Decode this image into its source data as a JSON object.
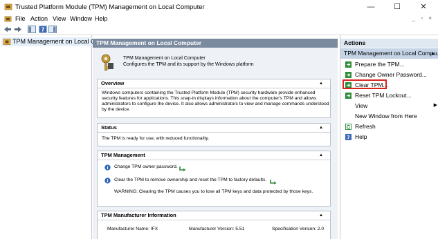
{
  "window": {
    "title": "Trusted Platform Module (TPM) Management on Local Computer",
    "minimize_glyph": "—",
    "maximize_glyph": "☐",
    "close_glyph": "✕"
  },
  "menu": {
    "items": [
      "File",
      "Action",
      "View",
      "Window",
      "Help"
    ],
    "mdi_controls": "_ ▫ ×"
  },
  "tree": {
    "root_label": "TPM Management on Local Comp"
  },
  "center": {
    "header": "TPM Management on Local Computer",
    "intro_title": "TPM Management on Local Computer",
    "intro_subtitle": "Configures the TPM and its support by the Windows platform",
    "overview": {
      "title": "Overview",
      "lines": [
        "Windows computers containing the Trusted Platform Module (TPM) security hardware provide enhanced",
        "security features for applications. This snap-in displays information about the computer's TPM and allows",
        "administrators to configure the device. It also allows administrators to view and manage commands understood",
        "by the device."
      ]
    },
    "status": {
      "title": "Status",
      "text": "The TPM is ready for use, with reduced functionality."
    },
    "management": {
      "title": "TPM Management",
      "change_password": "Change TPM owner password.",
      "clear_tpm": "Clear the TPM to remove ownership and reset the TPM to factory defaults.",
      "warning": "WARNING: Clearing the TPM causes you to lose all TPM keys and data protected by those keys."
    },
    "manufacturer": {
      "title": "TPM Manufacturer Information",
      "name": "Manufacturer Name:  IFX",
      "version": "Manufacturer Version:  5.51",
      "spec": "Specification Version:  2.0"
    }
  },
  "actions": {
    "header": "Actions",
    "section": "TPM Management on Local Compu...",
    "items": [
      "Prepare the TPM...",
      "Change Owner Password...",
      "Clear TPM...",
      "Reset TPM Lockout...",
      "View",
      "New Window from Here",
      "Refresh",
      "Help"
    ]
  },
  "colors": {
    "accent_header": "#7a8a9f",
    "actions_selected": "#c4d3e6",
    "highlight_box": "#d9231c",
    "green_action": "#2e8b3a"
  }
}
